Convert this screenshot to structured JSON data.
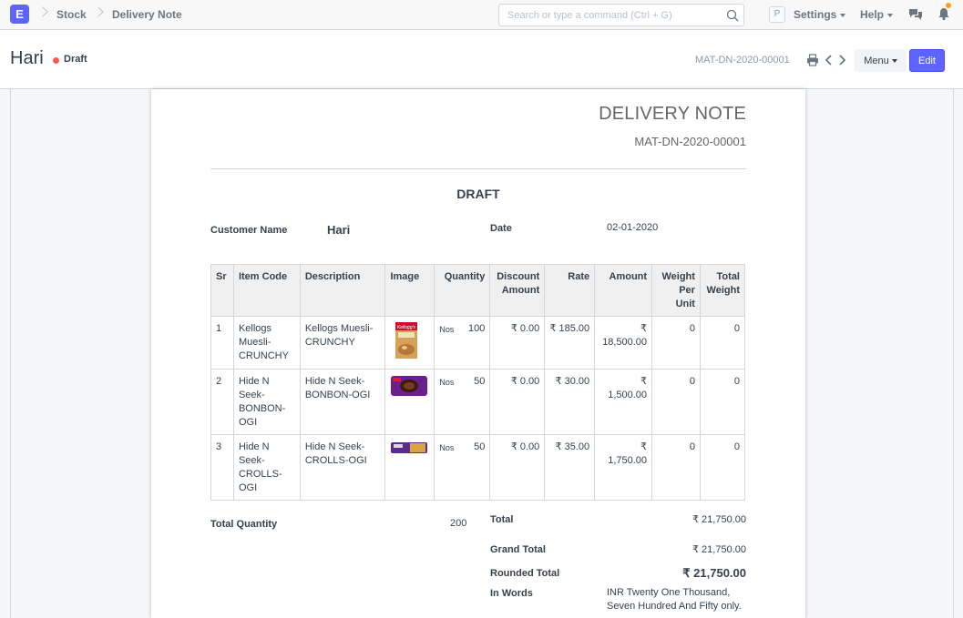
{
  "navbar": {
    "logo_letter": "E",
    "breadcrumbs": [
      "Stock",
      "Delivery Note"
    ],
    "search_placeholder": "Search or type a command (Ctrl + G)",
    "avatar_letter": "P",
    "settings_label": "Settings",
    "help_label": "Help"
  },
  "page_head": {
    "title": "Hari",
    "status": "Draft",
    "doc_name": "MAT-DN-2020-00001",
    "menu_label": "Menu",
    "edit_label": "Edit"
  },
  "document": {
    "heading": "DELIVERY NOTE",
    "doc_no": "MAT-DN-2020-00001",
    "status_banner": "DRAFT",
    "customer_label": "Customer Name",
    "customer_value": "Hari",
    "date_label": "Date",
    "date_value": "02-01-2020",
    "columns": [
      "Sr",
      "Item Code",
      "Description",
      "Image",
      "Quantity",
      "Discount Amount",
      "Rate",
      "Amount",
      "Weight Per Unit",
      "Total Weight"
    ],
    "rows": [
      {
        "sr": "1",
        "item_code": "Kellogs Muesli-CRUNCHY",
        "description": "Kellogs Muesli-CRUNCHY",
        "image": "cereal-pack",
        "uom": "Nos",
        "qty": "100",
        "discount": "₹ 0.00",
        "rate": "₹ 185.00",
        "amount": "₹ 18,500.00",
        "weight_per_unit": "0",
        "total_weight": "0"
      },
      {
        "sr": "2",
        "item_code": "Hide N Seek-BONBON-OGI",
        "description": "Hide N Seek-BONBON-OGI",
        "image": "biscuit-pack-purple",
        "uom": "Nos",
        "qty": "50",
        "discount": "₹ 0.00",
        "rate": "₹ 30.00",
        "amount": "₹ 1,500.00",
        "weight_per_unit": "0",
        "total_weight": "0"
      },
      {
        "sr": "3",
        "item_code": "Hide N Seek-CROLLS-OGI",
        "description": "Hide N Seek-CROLLS-OGI",
        "image": "biscuit-roll",
        "uom": "Nos",
        "qty": "50",
        "discount": "₹ 0.00",
        "rate": "₹ 35.00",
        "amount": "₹ 1,750.00",
        "weight_per_unit": "0",
        "total_weight": "0"
      }
    ],
    "total_qty_label": "Total Quantity",
    "total_qty_value": "200",
    "total_label": "Total",
    "total_value": "₹ 21,750.00",
    "grand_total_label": "Grand Total",
    "grand_total_value": "₹ 21,750.00",
    "rounded_total_label": "Rounded Total",
    "rounded_total_value": "₹ 21,750.00",
    "in_words_label": "In Words",
    "in_words_value": "INR Twenty One Thousand, Seven Hundred And Fifty only."
  },
  "colors": {
    "accent": "#5e64ff",
    "draft_dot": "#ff5858",
    "notification": "#ffa00a"
  }
}
